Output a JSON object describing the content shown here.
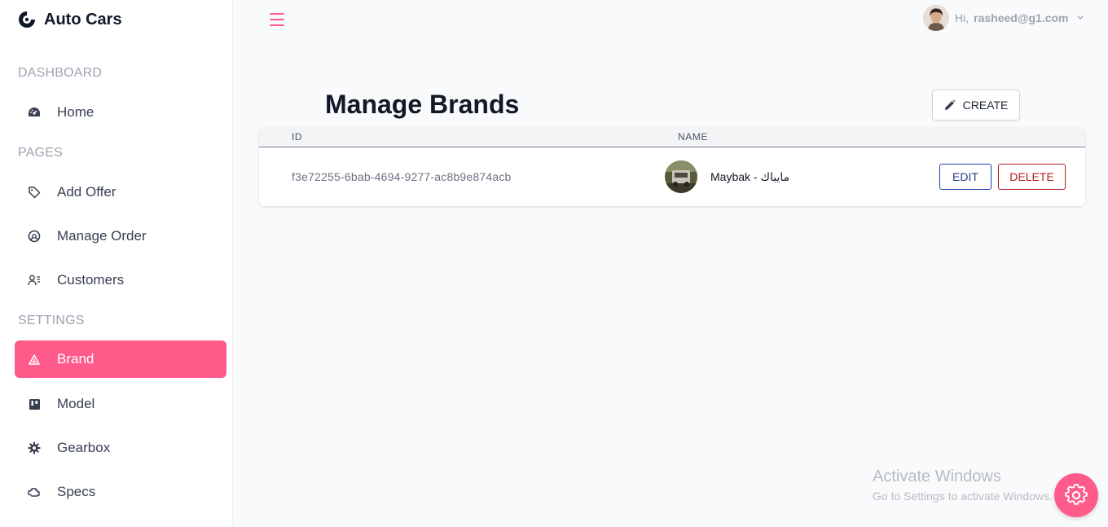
{
  "app": {
    "title": "Auto Cars"
  },
  "sidebar": {
    "sections": [
      {
        "label": "DASHBOARD"
      },
      {
        "label": "PAGES"
      },
      {
        "label": "SETTINGS"
      }
    ],
    "items": [
      {
        "label": "Home",
        "icon": "speedometer-icon"
      },
      {
        "label": "Add Offer",
        "icon": "tag-icon"
      },
      {
        "label": "Manage Order",
        "icon": "order-icon"
      },
      {
        "label": "Customers",
        "icon": "customers-icon"
      },
      {
        "label": "Brand",
        "icon": "brand-icon",
        "active": true
      },
      {
        "label": "Model",
        "icon": "model-icon"
      },
      {
        "label": "Gearbox",
        "icon": "gear-icon"
      },
      {
        "label": "Specs",
        "icon": "engine-icon"
      }
    ]
  },
  "header": {
    "greeting": "Hi,",
    "email": "rasheed@g1.com"
  },
  "main": {
    "title": "Manage Brands",
    "create_label": "CREATE",
    "table": {
      "columns": [
        "ID",
        "NAME"
      ],
      "rows": [
        {
          "id": "f3e72255-6bab-4694-9277-ac8b9e874acb",
          "name": "Maybak - مايباك",
          "edit_label": "EDIT",
          "delete_label": "DELETE"
        }
      ]
    }
  },
  "watermark": {
    "title": "Activate Windows",
    "subtitle": "Go to Settings to activate Windows."
  },
  "colors": {
    "accent": "#ff5b8a",
    "edit": "#1e40af",
    "delete": "#b91c1c"
  }
}
